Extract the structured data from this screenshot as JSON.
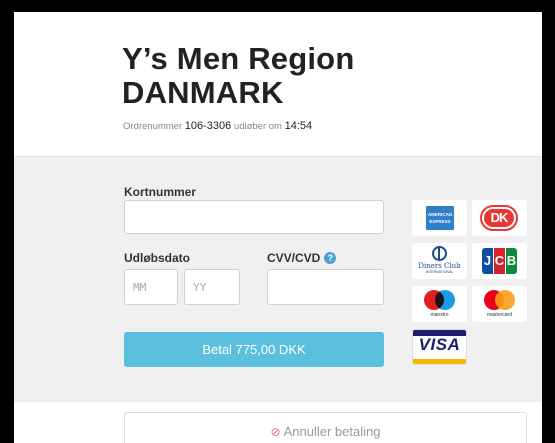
{
  "header": {
    "title_line1": "Y’s Men Region",
    "title_line2": "DANMARK",
    "order_label": "Ordrenummer",
    "order_number": "106-3306",
    "expires_label": "udløber om",
    "expires_time": "14:54"
  },
  "form": {
    "card_number_label": "Kortnummer",
    "card_number_value": "",
    "expiry_label": "Udløbsdato",
    "expiry_month_placeholder": "MM",
    "expiry_year_placeholder": "YY",
    "cvv_label": "CVV/CVD",
    "cvv_value": "",
    "pay_button_label": "Betal 775,00 DKK"
  },
  "card_logos": [
    {
      "name": "american-express",
      "text": "AMERICAN EXPRESS"
    },
    {
      "name": "dankort",
      "text": "DK"
    },
    {
      "name": "diners-club",
      "text": "Diners Club",
      "subtext": "INTERNATIONAL"
    },
    {
      "name": "jcb",
      "text": "JCB"
    },
    {
      "name": "maestro",
      "text": "maestro"
    },
    {
      "name": "mastercard",
      "text": "mastercard"
    },
    {
      "name": "visa",
      "text": "VISA"
    }
  ],
  "cancel": {
    "label": "Annuller betaling"
  },
  "colors": {
    "accent": "#5bc0de",
    "help_icon": "#4a9fd5",
    "form_background": "#f0f0f0",
    "cancel_icon": "#e07070"
  }
}
